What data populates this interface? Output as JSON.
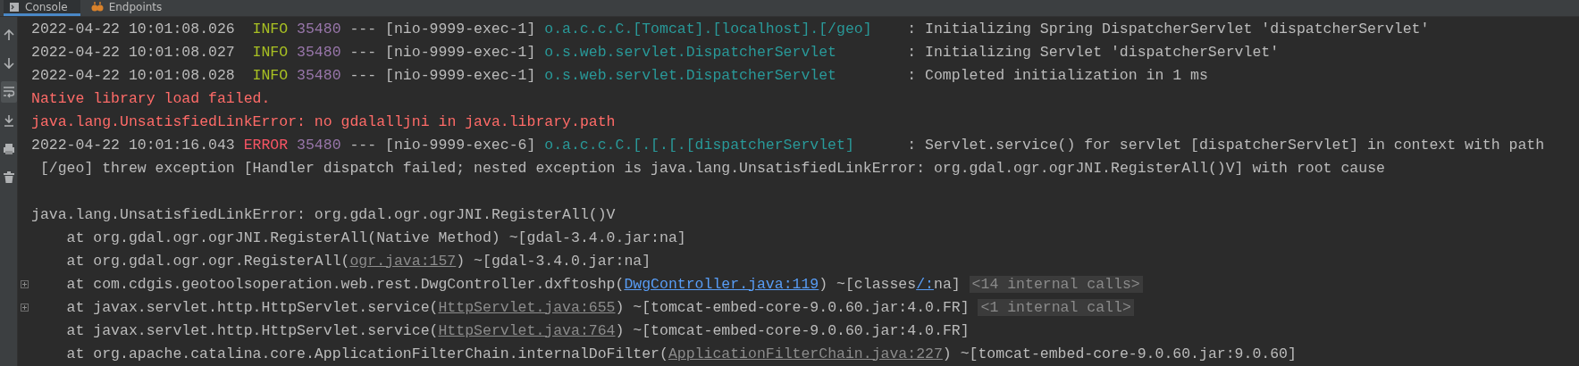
{
  "tabs": [
    {
      "label": "Console",
      "kind": "console",
      "selected": true
    },
    {
      "label": "Endpoints",
      "kind": "endpoints",
      "selected": false
    }
  ],
  "toolbar": [
    {
      "kind": "up",
      "selected": false
    },
    {
      "kind": "down",
      "selected": false
    },
    {
      "kind": "wrap",
      "selected": true
    },
    {
      "kind": "download",
      "selected": false
    },
    {
      "kind": "print",
      "selected": false
    },
    {
      "kind": "trash",
      "selected": false
    }
  ],
  "lines": [
    {
      "kind": "log",
      "foldable": false,
      "segments": [
        {
          "kind": "timestamp",
          "text": "2022-04-22 10:01:08.026"
        },
        {
          "kind": "level-info",
          "text": "INFO"
        },
        {
          "kind": "pid",
          "text": "35480"
        },
        {
          "kind": "thread",
          "text": "--- [nio-9999-exec-1]"
        },
        {
          "kind": "logger",
          "text": "o.a.c.c.C.[Tomcat].[localhost].[/geo]"
        },
        {
          "kind": "message",
          "text": ": Initializing Spring DispatcherServlet 'dispatcherServlet'"
        }
      ]
    },
    {
      "kind": "log",
      "foldable": false,
      "segments": [
        {
          "kind": "timestamp",
          "text": "2022-04-22 10:01:08.027"
        },
        {
          "kind": "level-info",
          "text": "INFO"
        },
        {
          "kind": "pid",
          "text": "35480"
        },
        {
          "kind": "thread",
          "text": "--- [nio-9999-exec-1]"
        },
        {
          "kind": "logger",
          "text": "o.s.web.servlet.DispatcherServlet"
        },
        {
          "kind": "message",
          "text": ": Initializing Servlet 'dispatcherServlet'"
        }
      ]
    },
    {
      "kind": "log",
      "foldable": false,
      "segments": [
        {
          "kind": "timestamp",
          "text": "2022-04-22 10:01:08.028"
        },
        {
          "kind": "level-info",
          "text": "INFO"
        },
        {
          "kind": "pid",
          "text": "35480"
        },
        {
          "kind": "thread",
          "text": "--- [nio-9999-exec-1]"
        },
        {
          "kind": "logger",
          "text": "o.s.web.servlet.DispatcherServlet"
        },
        {
          "kind": "message",
          "text": ": Completed initialization in 1 ms"
        }
      ]
    },
    {
      "kind": "plain",
      "foldable": false,
      "segments": [
        {
          "kind": "error",
          "text": "Native library load failed."
        }
      ]
    },
    {
      "kind": "plain",
      "foldable": false,
      "segments": [
        {
          "kind": "error",
          "text": "java.lang.UnsatisfiedLinkError: no gdalalljni in java.library.path"
        }
      ]
    },
    {
      "kind": "log",
      "foldable": false,
      "segments": [
        {
          "kind": "timestamp",
          "text": "2022-04-22 10:01:16.043"
        },
        {
          "kind": "level-error",
          "text": "ERROR"
        },
        {
          "kind": "pid",
          "text": "35480"
        },
        {
          "kind": "thread",
          "text": "--- [nio-9999-exec-6]"
        },
        {
          "kind": "logger",
          "text": "o.a.c.c.C.[.[.[.[dispatcherServlet]"
        },
        {
          "kind": "message",
          "text": ": Servlet.service() for servlet [dispatcherServlet] in context with path"
        }
      ]
    },
    {
      "kind": "wrap",
      "foldable": false,
      "segments": [
        {
          "kind": "message",
          "text": "[/geo] threw exception [Handler dispatch failed; nested exception is java.lang.UnsatisfiedLinkError: org.gdal.ogr.ogrJNI.RegisterAll()V] with root cause"
        }
      ]
    },
    {
      "kind": "blank",
      "foldable": false
    },
    {
      "kind": "plain",
      "foldable": false,
      "segments": [
        {
          "kind": "message",
          "text": "java.lang.UnsatisfiedLinkError: org.gdal.ogr.ogrJNI.RegisterAll()V"
        }
      ]
    },
    {
      "kind": "stack",
      "foldable": false,
      "segments": [
        {
          "kind": "frame",
          "text": "at org.gdal.ogr.ogrJNI.RegisterAll(Native Method) ~[gdal-3.4.0.jar:na]"
        }
      ]
    },
    {
      "kind": "stack",
      "foldable": false,
      "segments": [
        {
          "kind": "frame",
          "text": "at org.gdal.ogr.ogr.RegisterAll("
        },
        {
          "kind": "link",
          "text": "ogr.java:157"
        },
        {
          "kind": "frame",
          "text": ") ~[gdal-3.4.0.jar:na]"
        }
      ]
    },
    {
      "kind": "stack",
      "foldable": true,
      "segments": [
        {
          "kind": "frame",
          "text": "at com.cdgis.geotoolsoperation.web.rest.DwgController.dxftoshp("
        },
        {
          "kind": "link-project",
          "text": "DwgController.java:119"
        },
        {
          "kind": "frame",
          "text": ") ~[classes"
        },
        {
          "kind": "link-project",
          "text": "/:"
        },
        {
          "kind": "frame",
          "text": "na]"
        },
        {
          "kind": "hint",
          "text": "<14 internal calls>"
        }
      ]
    },
    {
      "kind": "stack",
      "foldable": true,
      "segments": [
        {
          "kind": "frame",
          "text": "at javax.servlet.http.HttpServlet.service("
        },
        {
          "kind": "link",
          "text": "HttpServlet.java:655"
        },
        {
          "kind": "frame",
          "text": ") ~[tomcat-embed-core-9.0.60.jar:4.0.FR]"
        },
        {
          "kind": "hint",
          "text": "<1 internal call>"
        }
      ]
    },
    {
      "kind": "stack",
      "foldable": false,
      "segments": [
        {
          "kind": "frame",
          "text": "at javax.servlet.http.HttpServlet.service("
        },
        {
          "kind": "link",
          "text": "HttpServlet.java:764"
        },
        {
          "kind": "frame",
          "text": ") ~[tomcat-embed-core-9.0.60.jar:4.0.FR]"
        }
      ]
    },
    {
      "kind": "stack",
      "foldable": false,
      "segments": [
        {
          "kind": "frame",
          "text": "at org.apache.catalina.core.ApplicationFilterChain.internalDoFilter("
        },
        {
          "kind": "link",
          "text": "ApplicationFilterChain.java:227"
        },
        {
          "kind": "frame",
          "text": ") ~[tomcat-embed-core-9.0.60.jar:9.0.60]"
        }
      ]
    }
  ]
}
